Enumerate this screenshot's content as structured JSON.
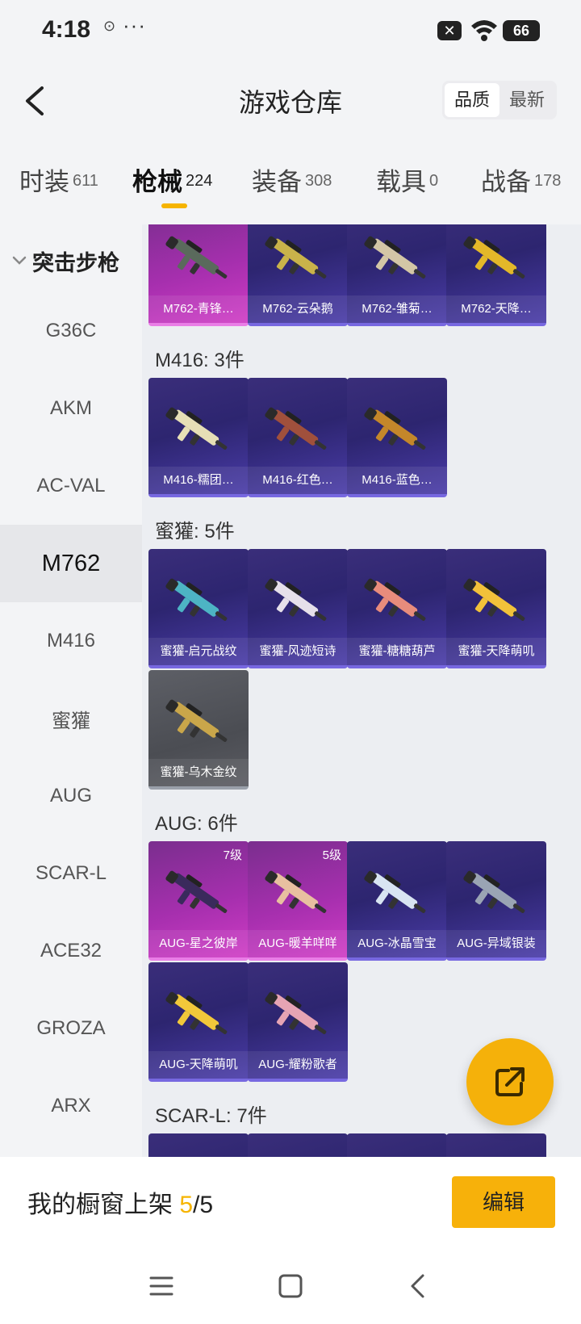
{
  "status_bar": {
    "time": "4:18",
    "more": "···",
    "battery": "66",
    "x_badge": "✕"
  },
  "header": {
    "title": "游戏仓库",
    "sort": [
      "品质",
      "最新"
    ]
  },
  "tabs": [
    {
      "label": "时装",
      "count": "611"
    },
    {
      "label": "枪械",
      "count": "224"
    },
    {
      "label": "装备",
      "count": "308"
    },
    {
      "label": "载具",
      "count": "0"
    },
    {
      "label": "战备",
      "count": "178"
    }
  ],
  "sidebar": {
    "group": "突击步枪",
    "items": [
      "G36C",
      "AKM",
      "AC-VAL",
      "M762",
      "M416",
      "蜜獾",
      "AUG",
      "SCAR-L",
      "ACE32",
      "GROZA",
      "ARX"
    ]
  },
  "sections": [
    {
      "title": "",
      "items": [
        {
          "name": "M762-青锋…",
          "rarity": "pink",
          "color": "#5a6a5c"
        },
        {
          "name": "M762-云朵鹅",
          "rarity": "purple",
          "color": "#c9b34a"
        },
        {
          "name": "M762-雏菊…",
          "rarity": "purple",
          "color": "#d3c6a6"
        },
        {
          "name": "M762-天降…",
          "rarity": "purple",
          "color": "#e3b829"
        }
      ]
    },
    {
      "title": "M416: 3件",
      "items": [
        {
          "name": "M416-糯团…",
          "rarity": "purple",
          "color": "#e6dfb6"
        },
        {
          "name": "M416-红色…",
          "rarity": "purple",
          "color": "#a0503c"
        },
        {
          "name": "M416-蓝色…",
          "rarity": "purple",
          "color": "#c4872a"
        }
      ]
    },
    {
      "title": "蜜獾: 5件",
      "items": [
        {
          "name": "蜜獾-启元战纹",
          "rarity": "purple",
          "color": "#4db4c4"
        },
        {
          "name": "蜜獾-风迹短诗",
          "rarity": "purple",
          "color": "#e6e0ea"
        },
        {
          "name": "蜜獾-糖糖葫芦",
          "rarity": "purple",
          "color": "#e88c7c"
        },
        {
          "name": "蜜獾-天降萌叽",
          "rarity": "purple",
          "color": "#f2c23a"
        },
        {
          "name": "蜜獾-乌木金纹",
          "rarity": "gray",
          "color": "#c9a64a"
        }
      ]
    },
    {
      "title": "AUG: 6件",
      "items": [
        {
          "name": "AUG-星之彼岸",
          "rarity": "pink",
          "color": "#3a2a5c",
          "level": "7级"
        },
        {
          "name": "AUG-暖羊咩咩",
          "rarity": "pink",
          "color": "#e8c0a0",
          "level": "5级"
        },
        {
          "name": "AUG-冰晶雪宝",
          "rarity": "purple",
          "color": "#d8e4f2"
        },
        {
          "name": "AUG-异域银装",
          "rarity": "purple",
          "color": "#9aa4b4"
        },
        {
          "name": "AUG-天降萌叽",
          "rarity": "purple",
          "color": "#f2c83a"
        },
        {
          "name": "AUG-耀粉歌者",
          "rarity": "purple",
          "color": "#e6a4b4"
        }
      ]
    },
    {
      "title": "SCAR-L: 7件",
      "items": [
        {
          "name": "",
          "rarity": "purple",
          "color": "#e87ca8"
        },
        {
          "name": "",
          "rarity": "purple",
          "color": "#c05068"
        },
        {
          "name": "",
          "rarity": "purple",
          "color": "#d0a040"
        },
        {
          "name": "",
          "rarity": "purple",
          "color": "#9aa4b4"
        }
      ]
    }
  ],
  "bottom": {
    "showcase_prefix": "我的橱窗上架 ",
    "showcase_current": "5",
    "showcase_total": "/5",
    "edit_label": "编辑"
  },
  "colors": {
    "accent": "#f6b400",
    "purple_card": "#2d2570",
    "pink_card": "#a62fae"
  }
}
